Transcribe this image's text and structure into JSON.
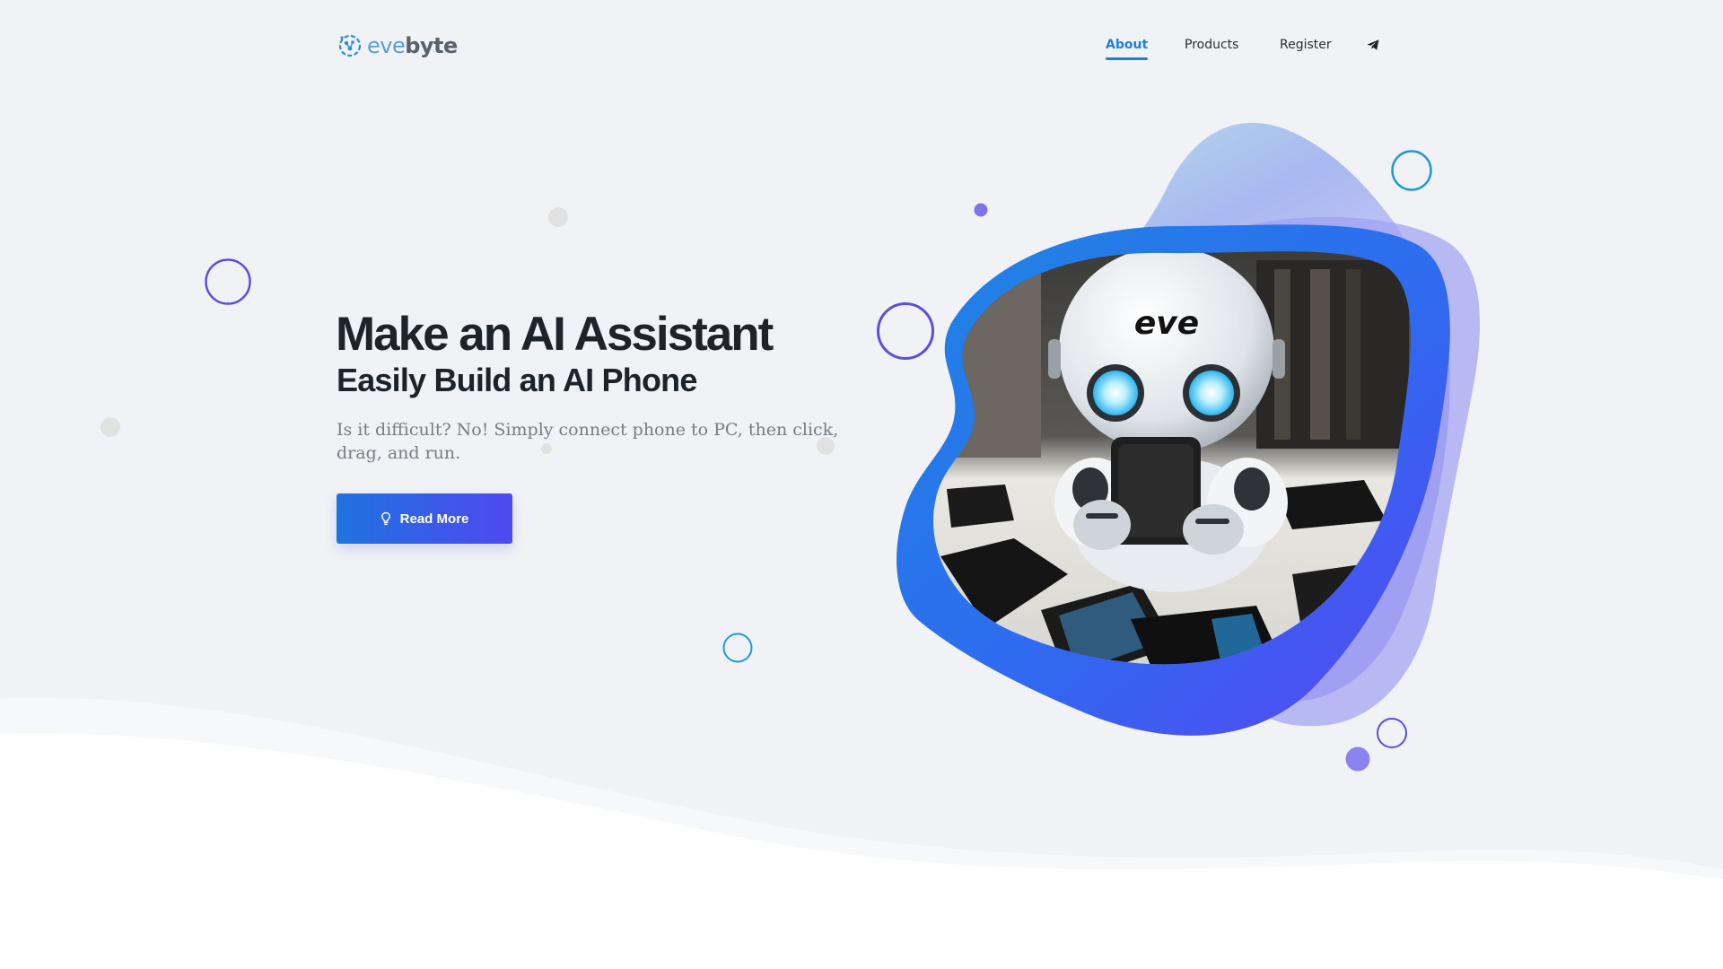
{
  "brand": {
    "name_part1": "eve",
    "name_part2": "byte",
    "logo_icon": "brain-circuit-icon",
    "colors": {
      "primary": "#1f7fd6",
      "accent": "#4f48f0",
      "heading": "#1e2229"
    }
  },
  "nav": {
    "items": [
      {
        "label": "About",
        "active": true
      },
      {
        "label": "Products",
        "active": false
      },
      {
        "label": "Register",
        "active": false
      }
    ],
    "telegram_icon": "telegram-icon"
  },
  "hero": {
    "title": "Make an AI Assistant",
    "subtitle": "Easily Build an AI Phone",
    "description": "Is it difficult? No! Simply connect phone to PC, then click, drag, and run.",
    "button_label": "Read More",
    "button_icon": "lightbulb-icon",
    "image_label": "eve"
  }
}
